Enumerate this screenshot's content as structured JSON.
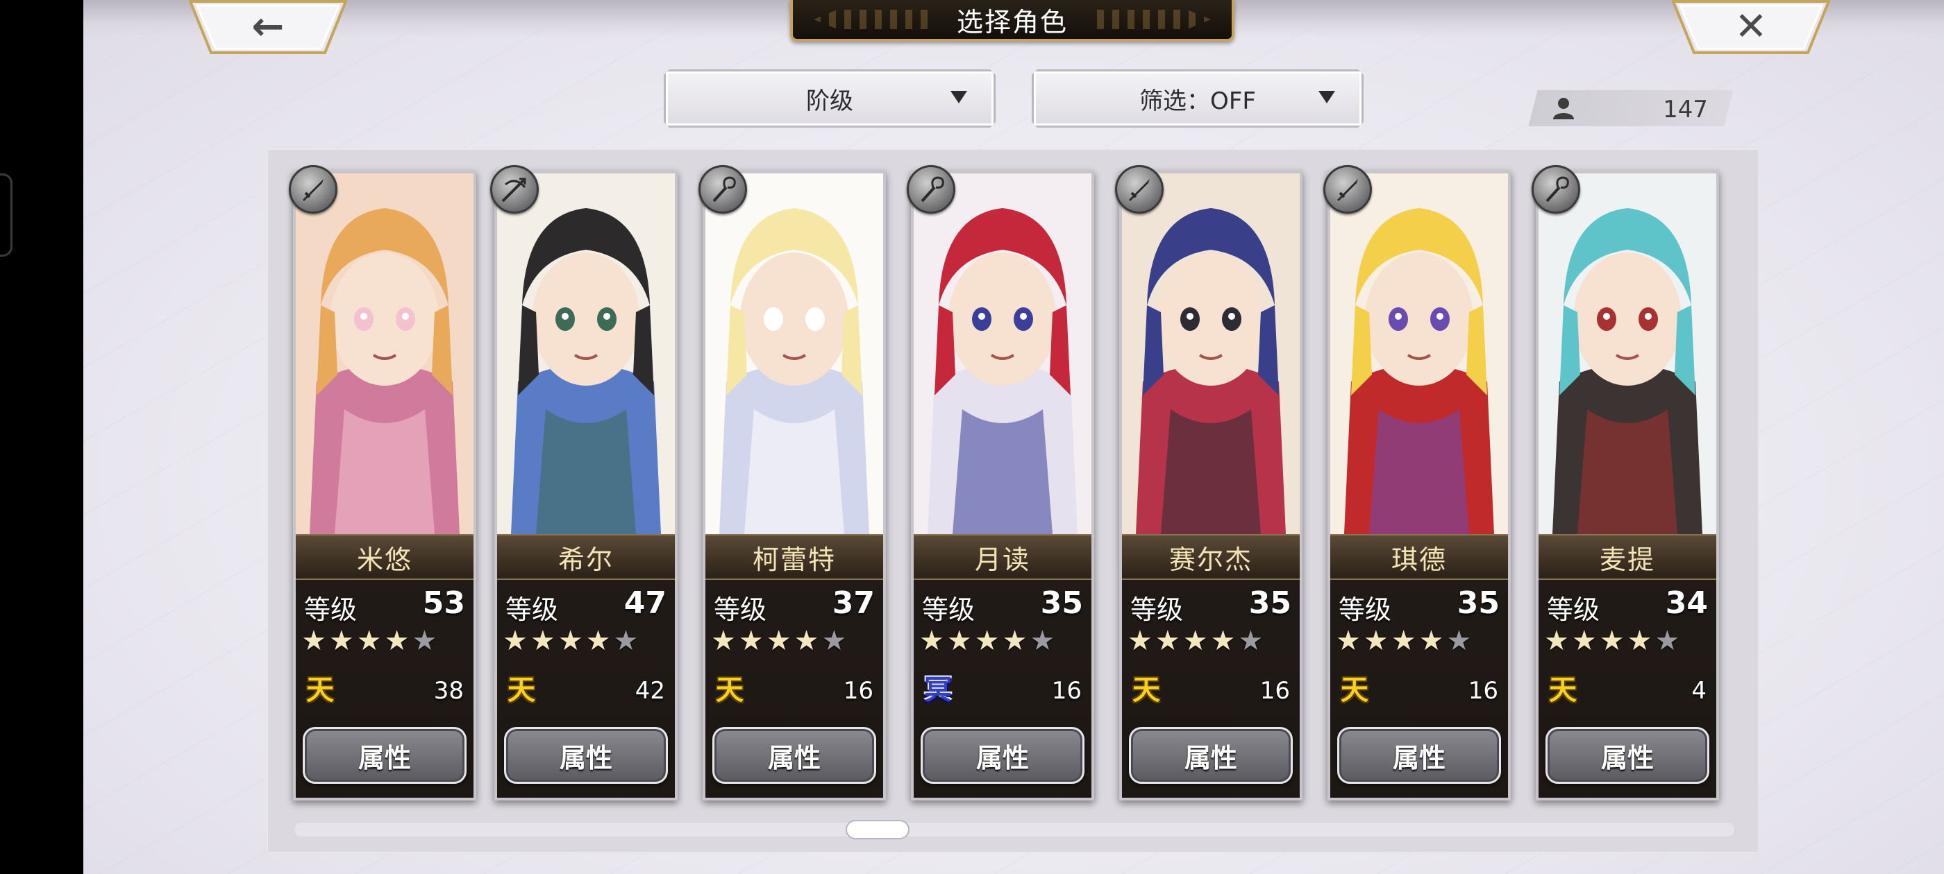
{
  "title": "选择角色",
  "nav": {
    "back_icon": "back-arrow-icon",
    "close_icon": "close-icon",
    "back_glyph": "←",
    "close_glyph": "✕"
  },
  "sort_dropdown": {
    "label": "阶级"
  },
  "filter_dropdown": {
    "label": "筛选：OFF"
  },
  "character_count": "147",
  "attr_label": "属性",
  "level_label": "等级",
  "characters": [
    {
      "name": "米悠",
      "level": "53",
      "stars": 4,
      "rank_glyph": "天",
      "rank_color": "gold",
      "sub_value": "38",
      "weapon": "sword-icon"
    },
    {
      "name": "希尔",
      "level": "47",
      "stars": 4,
      "rank_glyph": "天",
      "rank_color": "gold",
      "sub_value": "42",
      "weapon": "crossbow-icon"
    },
    {
      "name": "柯蕾特",
      "level": "37",
      "stars": 4,
      "rank_glyph": "天",
      "rank_color": "gold",
      "sub_value": "16",
      "weapon": "staff-icon"
    },
    {
      "name": "月读",
      "level": "35",
      "stars": 4,
      "rank_glyph": "冥",
      "rank_color": "blue",
      "sub_value": "16",
      "weapon": "staff-icon"
    },
    {
      "name": "赛尔杰",
      "level": "35",
      "stars": 4,
      "rank_glyph": "天",
      "rank_color": "gold",
      "sub_value": "16",
      "weapon": "sword-icon"
    },
    {
      "name": "琪德",
      "level": "35",
      "stars": 4,
      "rank_glyph": "天",
      "rank_color": "gold",
      "sub_value": "16",
      "weapon": "sword-icon"
    },
    {
      "name": "麦提",
      "level": "34",
      "stars": 4,
      "rank_glyph": "天",
      "rank_color": "gold",
      "sub_value": "4",
      "weapon": "staff-icon"
    }
  ],
  "colors": {
    "gold_rank": "#f7d21c",
    "blue_rank": "#3340c0",
    "name_text": "#f3e3b5",
    "title_plate": "#140f0a"
  }
}
